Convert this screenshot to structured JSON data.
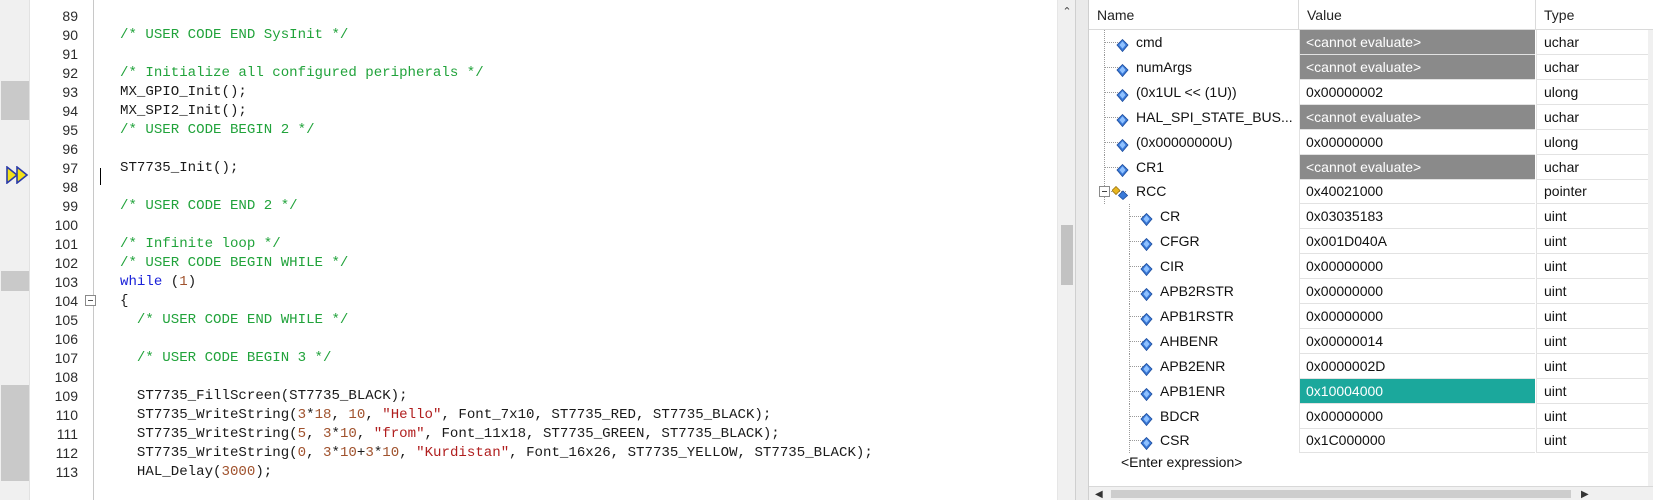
{
  "editor": {
    "lines": [
      {
        "n": "89",
        "tokens": []
      },
      {
        "n": "90",
        "indent": "",
        "tokens": [
          {
            "t": "/* USER CODE END SysInit */",
            "c": "cm"
          }
        ]
      },
      {
        "n": "91",
        "tokens": []
      },
      {
        "n": "92",
        "indent": "",
        "tokens": [
          {
            "t": "/* Initialize all configured peripherals */",
            "c": "cm"
          }
        ]
      },
      {
        "n": "93",
        "indent": "",
        "tokens": [
          {
            "t": "MX_GPIO_Init();",
            "c": ""
          }
        ]
      },
      {
        "n": "94",
        "indent": "",
        "tokens": [
          {
            "t": "MX_SPI2_Init();",
            "c": ""
          }
        ]
      },
      {
        "n": "95",
        "indent": "",
        "tokens": [
          {
            "t": "/* USER CODE BEGIN 2 */",
            "c": "cm"
          }
        ]
      },
      {
        "n": "96",
        "tokens": []
      },
      {
        "n": "97",
        "indent": "",
        "tokens": [
          {
            "t": "ST7735_Init();",
            "c": ""
          }
        ]
      },
      {
        "n": "98",
        "tokens": []
      },
      {
        "n": "99",
        "indent": "",
        "tokens": [
          {
            "t": "/* USER CODE END 2 */",
            "c": "cm"
          }
        ]
      },
      {
        "n": "100",
        "tokens": []
      },
      {
        "n": "101",
        "indent": "",
        "tokens": [
          {
            "t": "/* Infinite loop */",
            "c": "cm"
          }
        ]
      },
      {
        "n": "102",
        "indent": "",
        "tokens": [
          {
            "t": "/* USER CODE BEGIN WHILE */",
            "c": "cm"
          }
        ]
      },
      {
        "n": "103",
        "indent": "",
        "tokens": [
          {
            "t": "while",
            "c": "kw"
          },
          {
            "t": " (",
            "c": ""
          },
          {
            "t": "1",
            "c": "num"
          },
          {
            "t": ")",
            "c": ""
          }
        ]
      },
      {
        "n": "104",
        "indent": "",
        "tokens": [
          {
            "t": "{",
            "c": ""
          }
        ]
      },
      {
        "n": "105",
        "indent": "  ",
        "tokens": [
          {
            "t": "/* USER CODE END WHILE */",
            "c": "cm"
          }
        ]
      },
      {
        "n": "106",
        "tokens": []
      },
      {
        "n": "107",
        "indent": "  ",
        "tokens": [
          {
            "t": "/* USER CODE BEGIN 3 */",
            "c": "cm"
          }
        ]
      },
      {
        "n": "108",
        "tokens": []
      },
      {
        "n": "109",
        "indent": "  ",
        "tokens": [
          {
            "t": "ST7735_FillScreen(ST7735_BLACK);",
            "c": ""
          }
        ]
      },
      {
        "n": "110",
        "indent": "  ",
        "tokens": [
          {
            "t": "ST7735_WriteString(",
            "c": ""
          },
          {
            "t": "3",
            "c": "num"
          },
          {
            "t": "*",
            "c": ""
          },
          {
            "t": "18",
            "c": "num"
          },
          {
            "t": ", ",
            "c": ""
          },
          {
            "t": "10",
            "c": "num"
          },
          {
            "t": ", ",
            "c": ""
          },
          {
            "t": "\"Hello\"",
            "c": "str"
          },
          {
            "t": ", Font_7x10, ST7735_RED, ST7735_BLACK);",
            "c": ""
          }
        ]
      },
      {
        "n": "111",
        "indent": "  ",
        "tokens": [
          {
            "t": "ST7735_WriteString(",
            "c": ""
          },
          {
            "t": "5",
            "c": "num"
          },
          {
            "t": ", ",
            "c": ""
          },
          {
            "t": "3",
            "c": "num"
          },
          {
            "t": "*",
            "c": ""
          },
          {
            "t": "10",
            "c": "num"
          },
          {
            "t": ", ",
            "c": ""
          },
          {
            "t": "\"from\"",
            "c": "str"
          },
          {
            "t": ", Font_11x18, ST7735_GREEN, ST7735_BLACK);",
            "c": ""
          }
        ]
      },
      {
        "n": "112",
        "indent": "  ",
        "tokens": [
          {
            "t": "ST7735_WriteString(",
            "c": ""
          },
          {
            "t": "0",
            "c": "num"
          },
          {
            "t": ", ",
            "c": ""
          },
          {
            "t": "3",
            "c": "num"
          },
          {
            "t": "*",
            "c": ""
          },
          {
            "t": "10",
            "c": "num"
          },
          {
            "t": "+",
            "c": ""
          },
          {
            "t": "3",
            "c": "num"
          },
          {
            "t": "*",
            "c": ""
          },
          {
            "t": "10",
            "c": "num"
          },
          {
            "t": ", ",
            "c": ""
          },
          {
            "t": "\"Kurdistan\"",
            "c": "str"
          },
          {
            "t": ", Font_16x26, ST7735_YELLOW, ST7735_BLACK);",
            "c": ""
          }
        ]
      },
      {
        "n": "113",
        "indent": "  ",
        "tokens": [
          {
            "t": "HAL_Delay(",
            "c": ""
          },
          {
            "t": "3000",
            "c": "num"
          },
          {
            "t": ");",
            "c": ""
          }
        ]
      }
    ]
  },
  "watch": {
    "headers": {
      "name": "Name",
      "value": "Value",
      "type": "Type"
    },
    "rows": [
      {
        "name": "cmd",
        "value": "<cannot evaluate>",
        "type": "uchar",
        "state": "err",
        "level": 0,
        "icon": "variable-icon"
      },
      {
        "name": "numArgs",
        "value": "<cannot evaluate>",
        "type": "uchar",
        "state": "err",
        "level": 0,
        "icon": "variable-icon"
      },
      {
        "name": "(0x1UL << (1U))",
        "value": "0x00000002",
        "type": "ulong",
        "state": "",
        "level": 0,
        "icon": "variable-icon"
      },
      {
        "name": "HAL_SPI_STATE_BUS...",
        "value": "<cannot evaluate>",
        "type": "uchar",
        "state": "err",
        "level": 0,
        "icon": "variable-icon"
      },
      {
        "name": "(0x00000000U)",
        "value": "0x00000000",
        "type": "ulong",
        "state": "",
        "level": 0,
        "icon": "variable-icon"
      },
      {
        "name": "CR1",
        "value": "<cannot evaluate>",
        "type": "uchar",
        "state": "err",
        "level": 0,
        "icon": "variable-icon"
      },
      {
        "name": "RCC",
        "value": "0x40021000",
        "type": "pointer",
        "state": "",
        "level": 0,
        "icon": "struct-icon",
        "expanded": true
      },
      {
        "name": "CR",
        "value": "0x03035183",
        "type": "uint",
        "state": "",
        "level": 1,
        "icon": "variable-icon"
      },
      {
        "name": "CFGR",
        "value": "0x001D040A",
        "type": "uint",
        "state": "",
        "level": 1,
        "icon": "variable-icon"
      },
      {
        "name": "CIR",
        "value": "0x00000000",
        "type": "uint",
        "state": "",
        "level": 1,
        "icon": "variable-icon"
      },
      {
        "name": "APB2RSTR",
        "value": "0x00000000",
        "type": "uint",
        "state": "",
        "level": 1,
        "icon": "variable-icon"
      },
      {
        "name": "APB1RSTR",
        "value": "0x00000000",
        "type": "uint",
        "state": "",
        "level": 1,
        "icon": "variable-icon"
      },
      {
        "name": "AHBENR",
        "value": "0x00000014",
        "type": "uint",
        "state": "",
        "level": 1,
        "icon": "variable-icon"
      },
      {
        "name": "APB2ENR",
        "value": "0x0000002D",
        "type": "uint",
        "state": "",
        "level": 1,
        "icon": "variable-icon"
      },
      {
        "name": "APB1ENR",
        "value": "0x10004000",
        "type": "uint",
        "state": "hl",
        "level": 1,
        "icon": "variable-icon"
      },
      {
        "name": "BDCR",
        "value": "0x00000000",
        "type": "uint",
        "state": "",
        "level": 1,
        "icon": "variable-icon"
      },
      {
        "name": "CSR",
        "value": "0x1C000000",
        "type": "uint",
        "state": "",
        "level": 1,
        "icon": "variable-icon"
      }
    ],
    "enter_expression": "<Enter expression>"
  },
  "colors": {
    "comment": "#21a33b",
    "keyword": "#1b22d9",
    "number": "#a0522d",
    "string": "#b01e1e",
    "error_cell": "#8a8a8a",
    "changed_cell": "#1ba89c"
  }
}
